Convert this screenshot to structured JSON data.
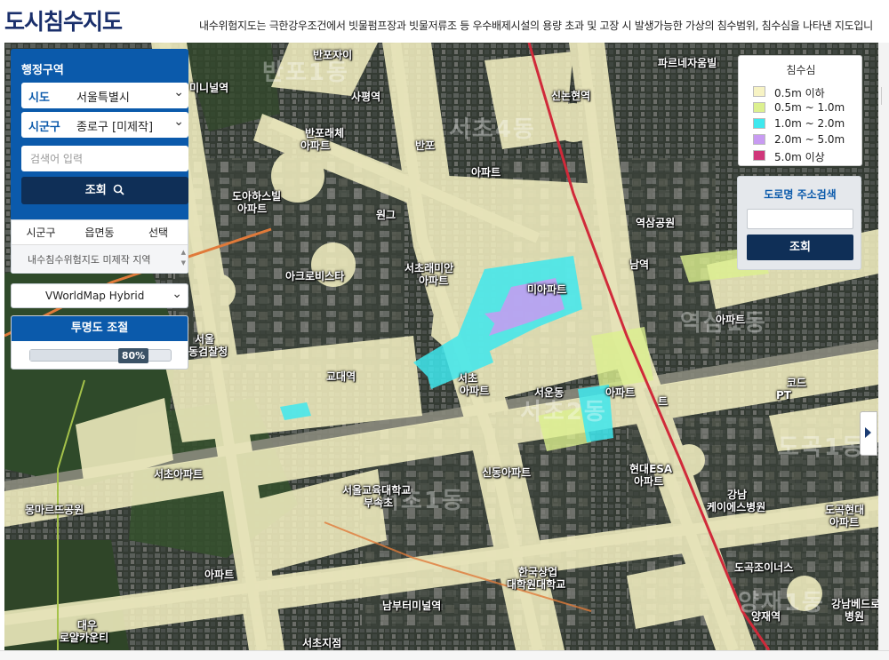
{
  "header": {
    "title": "도시침수지도",
    "description": "내수위험지도는 극한강우조건에서 빗물펌프장과 빗물저류조 등 우수배제시설의 용량 초과 및 고장 시 발생가능한 가상의 침수범위, 침수심을 나타낸 지도입니"
  },
  "admin_panel": {
    "title": "행정구역",
    "sido_label": "시도",
    "sido_value": "서울특별시",
    "sigungu_label": "시군구",
    "sigungu_value": "종로구 [미제작]",
    "search_placeholder": "검색어 입력",
    "query_button": "조회",
    "table_headers": [
      "시군구",
      "읍면동",
      "선택"
    ],
    "table_message": "내수침수위험지도 미제작 지역"
  },
  "basemap": {
    "selected": "VWorldMap Hybrid"
  },
  "opacity": {
    "title": "투명도 조절",
    "value_label": "80%",
    "value": 0.8
  },
  "legend": {
    "title": "침수심",
    "items": [
      {
        "label": "0.5m 이하",
        "color": "#f7f3c4"
      },
      {
        "label": "0.5m ~ 1.0m",
        "color": "#dcf08f"
      },
      {
        "label": "1.0m ~ 2.0m",
        "color": "#3fe8ee"
      },
      {
        "label": "2.0m ~ 5.0m",
        "color": "#c89bf2"
      },
      {
        "label": "5.0m 이상",
        "color": "#d0367a"
      }
    ]
  },
  "road_search": {
    "title": "도로명 주소검색",
    "button": "조회"
  },
  "map_labels": [
    {
      "text": "반포자이",
      "name": "map-label-banpo-xi"
    },
    {
      "text": "사평역",
      "name": "map-label-sapyeong-station"
    },
    {
      "text": "신논현역",
      "name": "map-label-sinnonhyeon-station"
    },
    {
      "text": "파르네자움빌",
      "name": "map-label-parnezaum"
    },
    {
      "text": "미니널역",
      "name": "map-label-station-1"
    },
    {
      "text": "반포래체",
      "name": "map-label-banpo-1"
    },
    {
      "text": "아파트",
      "name": "map-label-apt-1"
    },
    {
      "text": "반포",
      "name": "map-label-banpo-2"
    },
    {
      "text": "아파트",
      "name": "map-label-apt-2"
    },
    {
      "text": "역삼공원",
      "name": "map-label-yeoksam-park"
    },
    {
      "text": "도아하스빌",
      "name": "map-label-doa"
    },
    {
      "text": "아파트",
      "name": "map-label-apt-3"
    },
    {
      "text": "원그",
      "name": "map-label-won"
    },
    {
      "text": "남역",
      "name": "map-label-nam-station"
    },
    {
      "text": "아크로비스타",
      "name": "map-label-acro-vista"
    },
    {
      "text": "서초래미안",
      "name": "map-label-seocho-raemian"
    },
    {
      "text": "아파트",
      "name": "map-label-apt-4"
    },
    {
      "text": "아파트",
      "name": "map-label-apt-5"
    },
    {
      "text": "미아파트",
      "name": "map-label-apt-6"
    },
    {
      "text": "서울",
      "name": "map-label-seoul"
    },
    {
      "text": "동검찰청",
      "name": "map-label-prosecutor"
    },
    {
      "text": "교대역",
      "name": "map-label-gyodae-station"
    },
    {
      "text": "서초",
      "name": "map-label-seocho-1"
    },
    {
      "text": "아파트",
      "name": "map-label-apt-7"
    },
    {
      "text": "서운동",
      "name": "map-label-seoun"
    },
    {
      "text": "아파트",
      "name": "map-label-apt-8"
    },
    {
      "text": "트",
      "name": "map-label-t"
    },
    {
      "text": "코드",
      "name": "map-label-code"
    },
    {
      "text": "PT",
      "name": "map-label-pt"
    },
    {
      "text": "몽마르뜨공원",
      "name": "map-label-montmartre-park"
    },
    {
      "text": "서울교육대학교",
      "name": "map-label-seoul-edu-univ"
    },
    {
      "text": "부속초",
      "name": "map-label-elementary"
    },
    {
      "text": "신동아파트",
      "name": "map-label-sindong-apt"
    },
    {
      "text": "현대ESA",
      "name": "map-label-hyundai-esa"
    },
    {
      "text": "아파트",
      "name": "map-label-apt-9"
    },
    {
      "text": "강남",
      "name": "map-label-gangnam"
    },
    {
      "text": "케이에스병원",
      "name": "map-label-ks-hospital"
    },
    {
      "text": "도곡현대",
      "name": "map-label-dogok-hyundai"
    },
    {
      "text": "아파트",
      "name": "map-label-apt-10"
    },
    {
      "text": "한국상업",
      "name": "map-label-korea-commerce"
    },
    {
      "text": "대학원대학교",
      "name": "map-label-grad-school"
    },
    {
      "text": "도곡조이너스",
      "name": "map-label-dogok-joinus"
    },
    {
      "text": "남부터미널역",
      "name": "map-label-nambu-terminal"
    },
    {
      "text": "양재역",
      "name": "map-label-yangjae-station"
    },
    {
      "text": "강남베드로",
      "name": "map-label-gangnam-bedro"
    },
    {
      "text": "병원",
      "name": "map-label-hospital-2"
    },
    {
      "text": "대우",
      "name": "map-label-daewoo"
    },
    {
      "text": "로얄카운티",
      "name": "map-label-royal-county"
    },
    {
      "text": "서초지점",
      "name": "map-label-seocho-branch"
    },
    {
      "text": "아파트",
      "name": "map-label-apt-11"
    },
    {
      "text": "서초아파트",
      "name": "map-label-seocho-apt"
    }
  ],
  "map_district_labels": [
    {
      "text": "반포1동",
      "name": "map-district-banpo1"
    },
    {
      "text": "서초4동",
      "name": "map-district-seocho4"
    },
    {
      "text": "서초1동",
      "name": "map-district-seocho1"
    },
    {
      "text": "역삼1동",
      "name": "map-district-yeoksam1"
    },
    {
      "text": "도곡1동",
      "name": "map-district-dogok1"
    },
    {
      "text": "서초2동",
      "name": "map-district-seocho2"
    },
    {
      "text": "양재1동",
      "name": "map-district-yangjae1"
    }
  ]
}
